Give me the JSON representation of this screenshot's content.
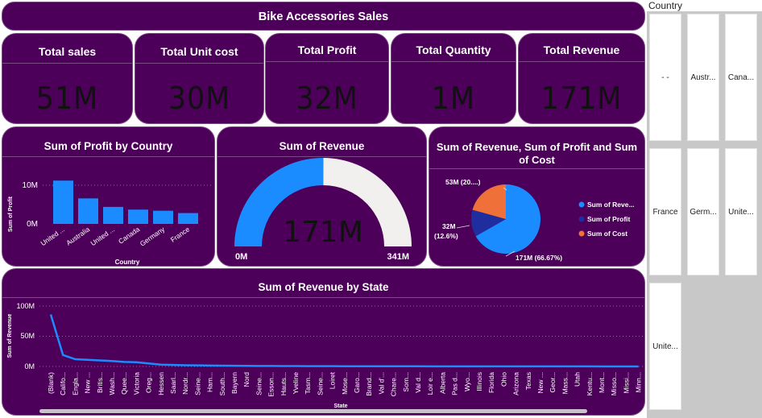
{
  "dashboard_title": "Bike Accessories Sales",
  "kpis": [
    {
      "title": "Total sales",
      "value": "51M"
    },
    {
      "title": "Total Unit cost",
      "value": "30M"
    },
    {
      "title": "Total Profit",
      "value": "32M"
    },
    {
      "title": "Total Quantity",
      "value": "1M"
    },
    {
      "title": "Total Revenue",
      "value": "171M"
    }
  ],
  "profit_chart": {
    "title": "Sum of Profit by Country",
    "ylabel": "Sum of Profit",
    "xlabel": "Country",
    "yticks": [
      "10M",
      "0M"
    ],
    "categories": [
      "United ...",
      "Australia",
      "United ...",
      "Canada",
      "Germany",
      "France"
    ]
  },
  "gauge": {
    "title": "Sum of Revenue",
    "value_label": "171M",
    "min_label": "0M",
    "max_label": "341M"
  },
  "pie": {
    "title_line1": "Sum of Revenue, Sum of Profit and Sum",
    "title_line2": "of Cost",
    "label_cost": "53M (20....)",
    "label_profit_1": "32M",
    "label_profit_2": "(12.6%)",
    "label_revenue": "171M (66.67%)",
    "legend": [
      "Sum of Reve...",
      "Sum of Profit",
      "Sum of Cost"
    ]
  },
  "state_chart": {
    "title": "Sum of Revenue by State",
    "ylabel": "Sum of Revenue",
    "xlabel": "State",
    "yticks": [
      "100M",
      "50M",
      "0M"
    ]
  },
  "slicer": {
    "title": "Country",
    "items": [
      "- -",
      "Austr...",
      "Cana...",
      "France",
      "Germ...",
      "Unite...",
      "Unite..."
    ]
  },
  "chart_data": [
    {
      "type": "bar",
      "title": "Sum of Profit by Country",
      "xlabel": "Country",
      "ylabel": "Sum of Profit",
      "categories": [
        "United ...",
        "Australia",
        "United ...",
        "Canada",
        "Germany",
        "France"
      ],
      "values": [
        11.2,
        6.6,
        4.4,
        3.7,
        3.4,
        2.8
      ],
      "ylim": [
        0,
        13
      ],
      "unit": "M",
      "colors": [
        "#1a8cff"
      ]
    },
    {
      "type": "gauge",
      "title": "Sum of Revenue",
      "value": 171,
      "min": 0,
      "max": 341,
      "unit": "M",
      "colors": [
        "#1a8cff",
        "#f2f0ef"
      ]
    },
    {
      "type": "pie",
      "title": "Sum of Revenue, Sum of Profit and Sum of Cost",
      "categories": [
        "Sum of Revenue",
        "Sum of Profit",
        "Sum of Cost"
      ],
      "values": [
        171,
        32,
        53
      ],
      "percent": [
        66.67,
        12.6,
        20.7
      ],
      "unit": "M",
      "colors": [
        "#1a8cff",
        "#1f2d9e",
        "#f0703a"
      ],
      "legend": "right"
    },
    {
      "type": "line",
      "title": "Sum of Revenue by State",
      "xlabel": "State",
      "ylabel": "Sum of Revenue",
      "ylim": [
        0,
        100
      ],
      "unit": "M",
      "x": [
        "(Blank)",
        "Califo...",
        "Engla...",
        "New ...",
        "Britis...",
        "Wash...",
        "Quee...",
        "Victoria",
        "Oreg...",
        "Hessen",
        "Saarl...",
        "Nordr...",
        "Seine...",
        "Ham...",
        "South...",
        "Bayern",
        "Nord",
        "Seine...",
        "Esson...",
        "Hauts...",
        "Yveline",
        "Tasm...",
        "Seine...",
        "Loiret",
        "Mose...",
        "Garo...",
        "Brand...",
        "Val d'...",
        "Chare...",
        "Som...",
        "Val d...",
        "Loir e...",
        "Alberta",
        "Pas d...",
        "Wyo...",
        "Illinois",
        "Florida",
        "Ohio",
        "Arizona",
        "Texas",
        "New ...",
        "Geor...",
        "Mass...",
        "Utah",
        "Kentu...",
        "Mont...",
        "Misso...",
        "Missi...",
        "Minn..."
      ],
      "values": [
        86,
        19,
        12,
        11,
        10,
        9,
        7.5,
        7,
        5,
        3,
        2.5,
        2,
        1.8,
        1.5,
        1.3,
        1.1,
        1,
        0.9,
        0.8,
        0.7,
        0.6,
        0.55,
        0.5,
        0.45,
        0.4,
        0.38,
        0.35,
        0.33,
        0.3,
        0.28,
        0.26,
        0.24,
        0.22,
        0.2,
        0.19,
        0.18,
        0.17,
        0.16,
        0.15,
        0.14,
        0.13,
        0.12,
        0.11,
        0.1,
        0.09,
        0.08,
        0.07,
        0.06,
        0.05
      ],
      "colors": [
        "#1a8cff"
      ]
    }
  ]
}
